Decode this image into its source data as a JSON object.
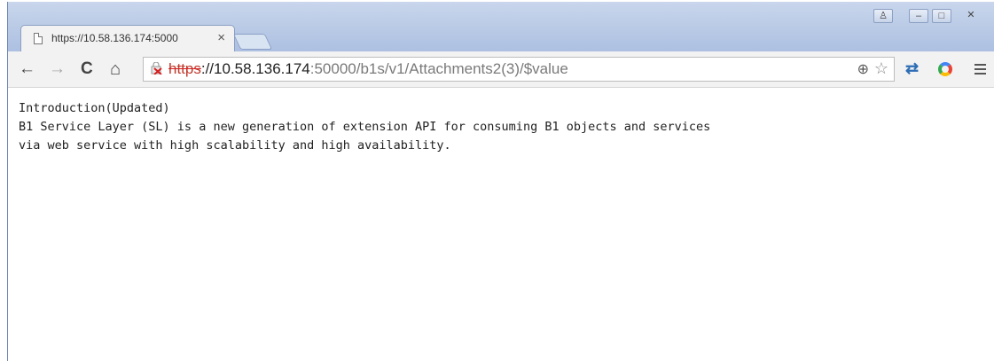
{
  "browser": {
    "tab": {
      "title": "https://10.58.136.174:5000",
      "close": "×"
    },
    "window_controls": {
      "profile": "♙",
      "minimize": "–",
      "maximize": "□",
      "close": "✕"
    },
    "nav": {
      "back": "←",
      "forward": "→",
      "reload": "C",
      "home": "⌂"
    },
    "address_bar": {
      "scheme": "https",
      "host": "://10.58.136.174",
      "rest": ":50000/b1s/v1/Attachments2(3)/$value",
      "security": "insecure-lock-icon"
    },
    "icons": {
      "zoom": "⊕",
      "bookmark": "☆",
      "sync": "⇄",
      "menu": "menu-icon"
    }
  },
  "page": {
    "lines": [
      "Introduction(Updated)",
      "B1 Service Layer (SL) is a new generation of extension API for consuming B1 objects and services",
      "via web service with high scalability and high availability."
    ]
  }
}
